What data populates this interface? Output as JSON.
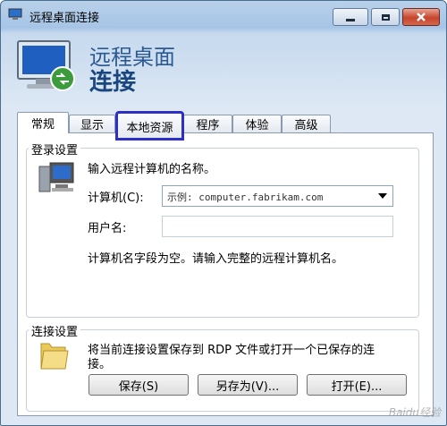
{
  "window": {
    "title": "远程桌面连接"
  },
  "hero": {
    "line1": "远程桌面",
    "line2": "连接"
  },
  "tabs": [
    {
      "label": "常规"
    },
    {
      "label": "显示"
    },
    {
      "label": "本地资源"
    },
    {
      "label": "程序"
    },
    {
      "label": "体验"
    },
    {
      "label": "高级"
    }
  ],
  "login": {
    "group_title": "登录设置",
    "prompt": "输入远程计算机的名称。",
    "computer_label": "计算机(C):",
    "computer_placeholder": "示例: computer.fabrikam.com",
    "username_label": "用户名:",
    "username_value": "",
    "message": "计算机名字段为空。请输入完整的远程计算机名。"
  },
  "connection": {
    "group_title": "连接设置",
    "desc_line1": "将当前连接设置保存到 RDP 文件或打开一个已保存的连",
    "desc_line2": "接。",
    "save_label": "保存(S)",
    "save_as_label": "另存为(V)...",
    "open_label": "打开(E)..."
  },
  "watermark": "Baidu经验",
  "colors": {
    "tab_highlight": "#2e2fc4",
    "hero_text": "#2b5a93"
  }
}
